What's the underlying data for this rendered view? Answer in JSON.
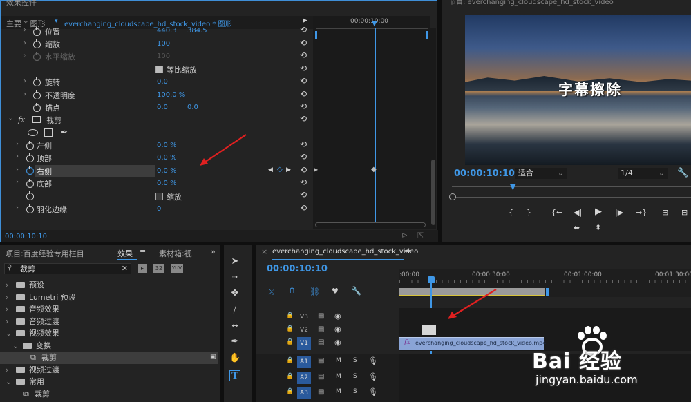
{
  "effect_controls": {
    "header_title": "效果控件",
    "tab_master": "主要 * 图形",
    "tab_clip": "everchanging_cloudscape_hd_stock_video * 图形",
    "ruler_time": "00:00:10:00",
    "current_time": "00:00:10:10",
    "props": [
      {
        "label": "位置",
        "v1": "440.3",
        "v2": "384.5"
      },
      {
        "label": "缩放",
        "v1": "100"
      },
      {
        "label": "水平缩放",
        "v1": "100"
      },
      {
        "label": "等比缩放"
      },
      {
        "label": "旋转",
        "v1": "0.0"
      },
      {
        "label": "不透明度",
        "v1": "100.0 %"
      },
      {
        "label": "锚点",
        "v1": "0.0",
        "v2": "0.0"
      }
    ],
    "crop_title": "裁剪",
    "crop_props": [
      {
        "label": "左侧",
        "v1": "0.0 %"
      },
      {
        "label": "顶部",
        "v1": "0.0 %"
      },
      {
        "label": "右侧",
        "v1": "0.0 %"
      },
      {
        "label": "底部",
        "v1": "0.0 %"
      },
      {
        "label": "缩放"
      },
      {
        "label": "羽化边缘",
        "v1": "0"
      }
    ],
    "fx": "fx"
  },
  "program": {
    "title": "节目: everchanging_cloudscape_hd_stock_video",
    "overlay_text": "字幕擦除",
    "timecode": "00:00:10:10",
    "fit": "适合",
    "resolution": "1/4"
  },
  "project": {
    "tab_project": "项目:百度经验专用栏目",
    "tab_effects": "效果",
    "tab_bins": "素材箱:视",
    "search_value": "裁剪",
    "filter_a": "32",
    "filter_b": "YUV",
    "tree": [
      {
        "label": "预设",
        "level": 0
      },
      {
        "label": "Lumetri 预设",
        "level": 0
      },
      {
        "label": "音频效果",
        "level": 0
      },
      {
        "label": "音频过渡",
        "level": 0
      },
      {
        "label": "视频效果",
        "level": 0
      },
      {
        "label": "变换",
        "level": 1
      },
      {
        "label": "裁剪",
        "level": 2
      },
      {
        "label": "视频过渡",
        "level": 0
      },
      {
        "label": "常用",
        "level": 0
      },
      {
        "label": "裁剪",
        "level": 1
      }
    ]
  },
  "timeline": {
    "sequence_name": "everchanging_cloudscape_hd_stock_video",
    "timecode": "00:00:10:10",
    "ruler": [
      ":00:00",
      "00:00:30:00",
      "00:01:00:00",
      "00:01:30:00"
    ],
    "tracks_video": [
      "V3",
      "V2",
      "V1"
    ],
    "tracks_audio": [
      "A1",
      "A2",
      "A3"
    ],
    "clip_name": "everchanging_cloudscape_hd_stock_video.mp4",
    "mute": "M",
    "solo": "S",
    "fx": "fx"
  },
  "watermark": {
    "brand": "Bai 经验",
    "url": "jingyan.baidu.com"
  },
  "colors": {
    "accent": "#3f97e6",
    "panel": "#232323",
    "selected_row": "#3d3d3d",
    "clip_blue": "#8aa4d6",
    "arrow_red": "#e02020"
  }
}
